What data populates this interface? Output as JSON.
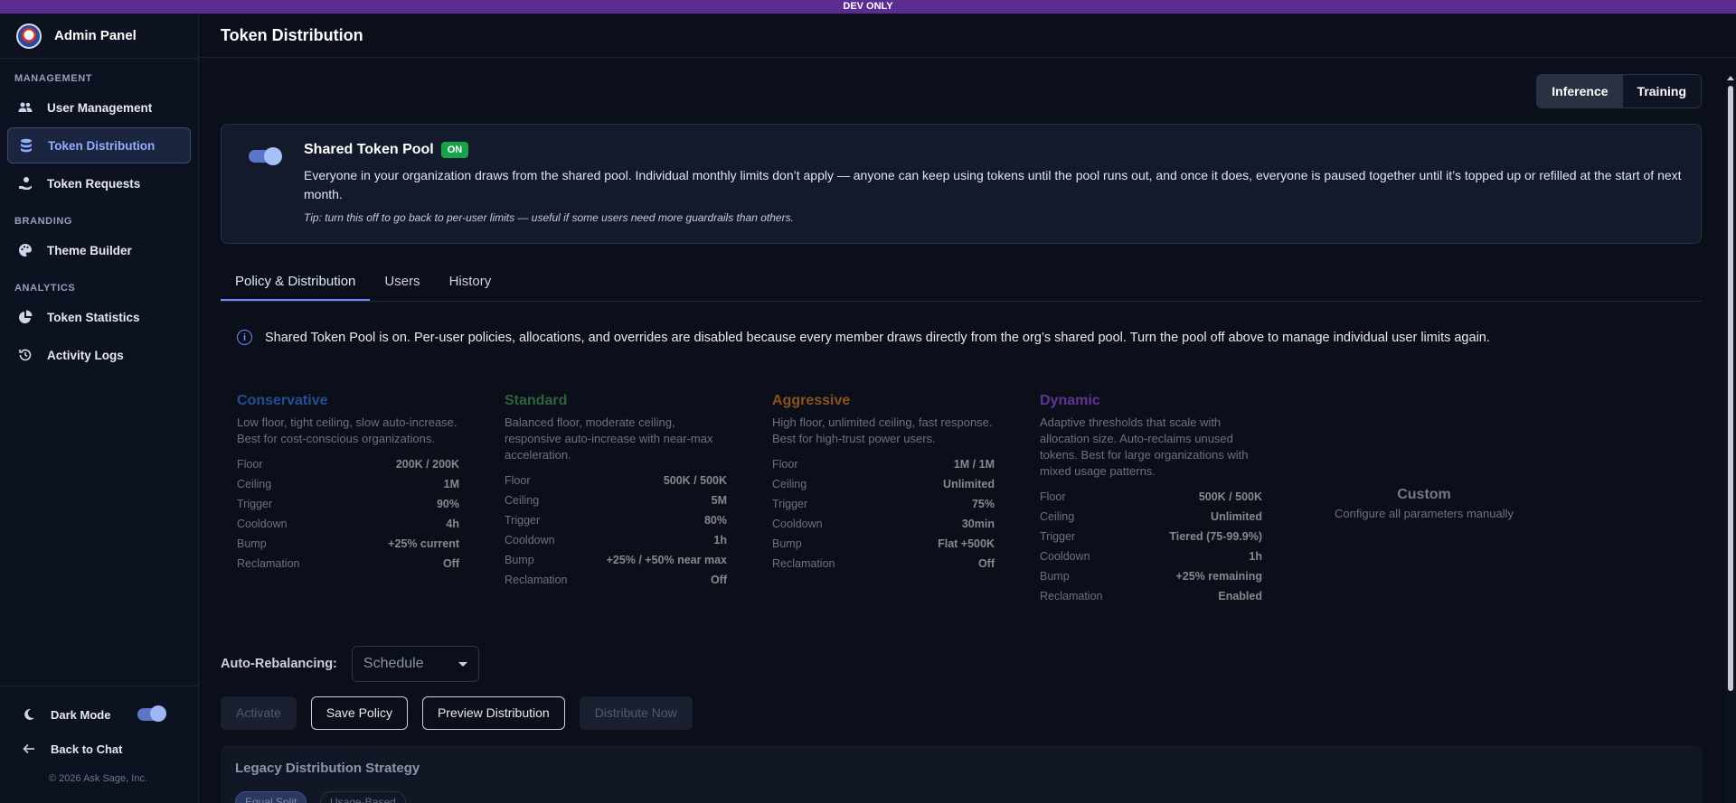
{
  "devbar": "DEV ONLY",
  "brand": {
    "title": "Admin Panel"
  },
  "sidebar": {
    "sections": [
      {
        "label": "MANAGEMENT"
      },
      {
        "label": "BRANDING"
      },
      {
        "label": "ANALYTICS"
      }
    ],
    "items": [
      {
        "label": "User Management",
        "icon": "users-icon"
      },
      {
        "label": "Token Distribution",
        "icon": "database-icon",
        "active": true
      },
      {
        "label": "Token Requests",
        "icon": "hand-coins-icon"
      },
      {
        "label": "Theme Builder",
        "icon": "palette-icon"
      },
      {
        "label": "Token Statistics",
        "icon": "pie-chart-icon"
      },
      {
        "label": "Activity Logs",
        "icon": "history-icon"
      }
    ],
    "bottom": {
      "dark_mode_label": "Dark Mode",
      "dark_mode_on": true,
      "back_label": "Back to Chat",
      "copyright": "© 2026 Ask Sage, Inc."
    }
  },
  "header": {
    "title": "Token Distribution"
  },
  "mode_switch": {
    "options": [
      "Inference",
      "Training"
    ],
    "selected": "Inference"
  },
  "pool": {
    "title": "Shared Token Pool",
    "badge": "ON",
    "enabled": true,
    "description": "Everyone in your organization draws from the shared pool. Individual monthly limits don’t apply — anyone can keep using tokens until the pool runs out, and once it does, everyone is paused together until it’s topped up or refilled at the start of next month.",
    "tip": "Tip: turn this off to go back to per-user limits — useful if some users need more guardrails than others."
  },
  "tabs": [
    "Policy & Distribution",
    "Users",
    "History"
  ],
  "active_tab": "Policy & Distribution",
  "info": "Shared Token Pool is on. Per-user policies, allocations, and overrides are disabled because every member draws directly from the org’s shared pool. Turn the pool off above to manage individual user limits again.",
  "policies": [
    {
      "name": "Conservative",
      "color": "#3b82f6",
      "desc": "Low floor, tight ceiling, slow auto-increase. Best for cost-conscious organizations.",
      "rows": [
        [
          "Floor",
          "200K / 200K"
        ],
        [
          "Ceiling",
          "1M"
        ],
        [
          "Trigger",
          "90%"
        ],
        [
          "Cooldown",
          "4h"
        ],
        [
          "Bump",
          "+25% current"
        ],
        [
          "Reclamation",
          "Off"
        ]
      ]
    },
    {
      "name": "Standard",
      "color": "#4ea85a",
      "desc": "Balanced floor, moderate ceiling, responsive auto-increase with near-max acceleration.",
      "rows": [
        [
          "Floor",
          "500K / 500K"
        ],
        [
          "Ceiling",
          "5M"
        ],
        [
          "Trigger",
          "80%"
        ],
        [
          "Cooldown",
          "1h"
        ],
        [
          "Bump",
          "+25% / +50% near max"
        ],
        [
          "Reclamation",
          "Off"
        ]
      ]
    },
    {
      "name": "Aggressive",
      "color": "#f08a24",
      "desc": "High floor, unlimited ceiling, fast response. Best for high-trust power users.",
      "rows": [
        [
          "Floor",
          "1M / 1M"
        ],
        [
          "Ceiling",
          "Unlimited"
        ],
        [
          "Trigger",
          "75%"
        ],
        [
          "Cooldown",
          "30min"
        ],
        [
          "Bump",
          "Flat +500K"
        ],
        [
          "Reclamation",
          "Off"
        ]
      ]
    },
    {
      "name": "Dynamic",
      "color": "#a855f7",
      "desc": "Adaptive thresholds that scale with allocation size. Auto-reclaims unused tokens. Best for large organizations with mixed usage patterns.",
      "rows": [
        [
          "Floor",
          "500K / 500K"
        ],
        [
          "Ceiling",
          "Unlimited"
        ],
        [
          "Trigger",
          "Tiered (75-99.9%)"
        ],
        [
          "Cooldown",
          "1h"
        ],
        [
          "Bump",
          "+25% remaining"
        ],
        [
          "Reclamation",
          "Enabled"
        ]
      ]
    }
  ],
  "custom": {
    "title": "Custom",
    "subtitle": "Configure all parameters manually"
  },
  "rebalancing": {
    "label": "Auto-Rebalancing:",
    "value": "Schedule"
  },
  "actions": {
    "activate": "Activate",
    "save": "Save Policy",
    "preview": "Preview Distribution",
    "distribute": "Distribute Now"
  },
  "legacy": {
    "title": "Legacy Distribution Strategy",
    "options": [
      "Equal Split",
      "Usage-Based"
    ],
    "selected": "Equal Split"
  }
}
